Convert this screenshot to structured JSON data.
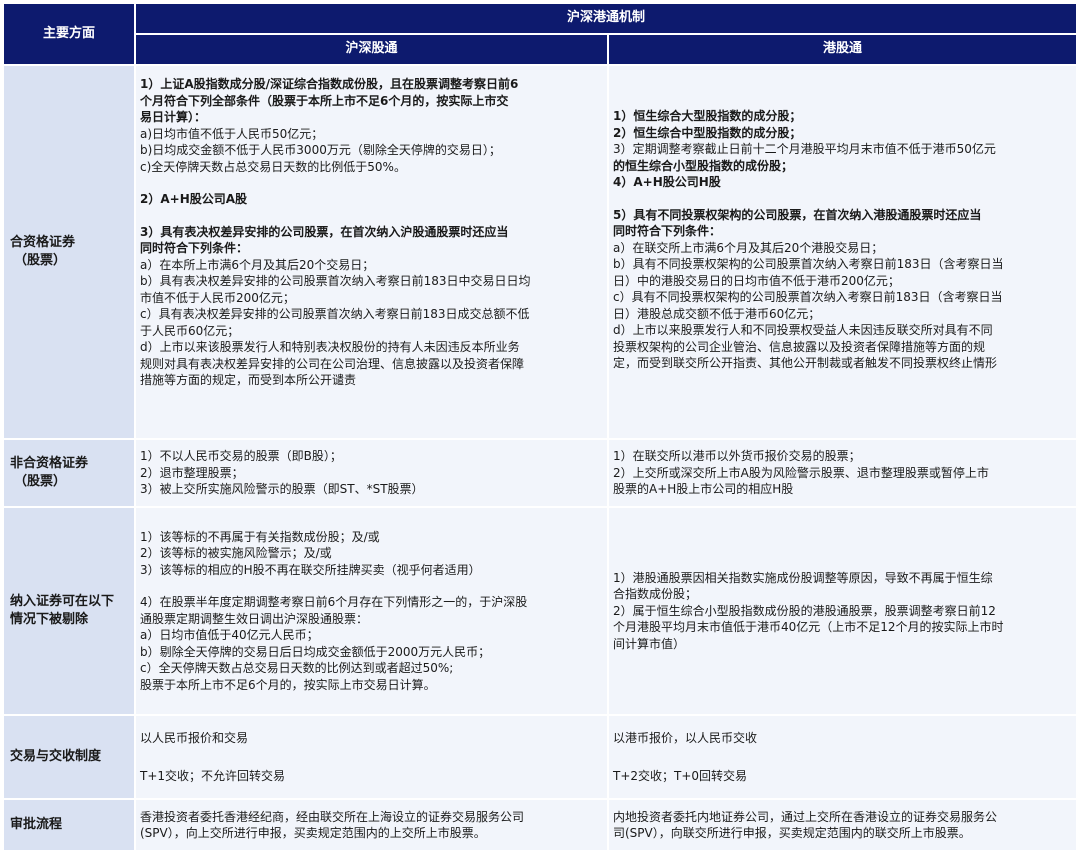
{
  "header": {
    "left": "主要方面",
    "top": "沪深港通机制",
    "col_a": "沪深股通",
    "col_b": "港股通"
  },
  "rows": {
    "eligible": {
      "label": [
        "合资格证券",
        "（股票）"
      ],
      "a": [
        {
          "t": "1）上证A股指数成分股/深证综合指数成份股，且在股票调整考察日前6",
          "b": true
        },
        {
          "t": "个月符合下列全部条件（股票于本所上市不足6个月的，按实际上市交",
          "b": true
        },
        {
          "t": "易日计算）：",
          "b": true
        },
        {
          "t": "a)日均市值不低于人民币50亿元；",
          "b": false
        },
        {
          "t": "b)日均成交金额不低于人民币3000万元（剔除全天停牌的交易日）；",
          "b": false
        },
        {
          "t": "c)全天停牌天数占总交易日天数的比例低于50%。",
          "b": false
        },
        {
          "gap": true
        },
        {
          "t": "2）A+H股公司A股",
          "b": true
        },
        {
          "gap": true
        },
        {
          "t": "3）具有表决权差异安排的公司股票，在首次纳入沪股通股票时还应当",
          "b": true
        },
        {
          "t": "同时符合下列条件：",
          "b": true
        },
        {
          "t": "a）在本所上市满6个月及其后20个交易日；",
          "b": false
        },
        {
          "t": "b）具有表决权差异安排的公司股票首次纳入考察日前183日中交易日日均",
          "b": false
        },
        {
          "t": "市值不低于人民币200亿元；",
          "b": false
        },
        {
          "t": "c）具有表决权差异安排的公司股票首次纳入考察日前183日成交总额不低",
          "b": false
        },
        {
          "t": "于人民币60亿元；",
          "b": false
        },
        {
          "t": "d）上市以来该股票发行人和特别表决权股份的持有人未因违反本所业务",
          "b": false
        },
        {
          "t": "规则对具有表决权差异安排的公司在公司治理、信息披露以及投资者保障",
          "b": false
        },
        {
          "t": "措施等方面的规定，而受到本所公开谴责",
          "b": false
        }
      ],
      "b": [
        {
          "t": "1）恒生综合大型股指数的成分股；",
          "b": true
        },
        {
          "t": "2）恒生综合中型股指数的成分股；",
          "b": true
        },
        {
          "t": "3）定期调整考察截止日前十二个月港股平均月末市值不低于港币50亿元",
          "b": false,
          "mixed": "3"
        },
        {
          "t": "的恒生综合小型股指数的成份股；",
          "b": true
        },
        {
          "t": "4）A+H股公司H股",
          "b": true
        },
        {
          "gap": true
        },
        {
          "t": "5）具有不同投票权架构的公司股票，在首次纳入港股通股票时还应当",
          "b": true
        },
        {
          "t": "同时符合下列条件：",
          "b": true
        },
        {
          "t": "a）在联交所上市满6个月及其后20个港股交易日；",
          "b": false
        },
        {
          "t": "b）具有不同投票权架构的公司股票首次纳入考察日前183日（含考察日当",
          "b": false
        },
        {
          "t": "日）中的港股交易日的日均市值不低于港币200亿元；",
          "b": false
        },
        {
          "t": "c）具有不同投票权架构的公司股票首次纳入考察日前183日（含考察日当",
          "b": false
        },
        {
          "t": "日）港股总成交额不低于港币60亿元；",
          "b": false
        },
        {
          "t": "d）上市以来股票发行人和不同投票权受益人未因违反联交所对具有不同",
          "b": false
        },
        {
          "t": "投票权架构的公司企业管治、信息披露以及投资者保障措施等方面的规",
          "b": false
        },
        {
          "t": "定，而受到联交所公开指责、其他公开制裁或者触发不同投票权终止情形",
          "b": false
        }
      ]
    },
    "ineligible": {
      "label": [
        "非合资格证券",
        "（股票）"
      ],
      "a": [
        "1）不以人民币交易的股票（即B股）；",
        "2）退市整理股票；",
        "3）被上交所实施风险警示的股票（即ST、*ST股票）"
      ],
      "b": [
        "1）在联交所以港币以外货币报价交易的股票；",
        "2）上交所或深交所上市A股为风险警示股票、退市整理股票或暂停上市",
        "股票的A+H股上市公司的相应H股"
      ]
    },
    "removal": {
      "label": [
        "纳入证券可在以下",
        "情况下被剔除"
      ],
      "a": [
        "1）该等标的不再属于有关指数成份股；及/或",
        "2）该等标的被实施风险警示；及/或",
        "3）该等标的相应的H股不再在联交所挂牌买卖（视乎何者适用）",
        "",
        "4）在股票半年度定期调整考察日前6个月存在下列情形之一的，于沪深股",
        "通股票定期调整生效日调出沪深股通股票：",
        "a）日均市值低于40亿元人民币；",
        "b）剔除全天停牌的交易日后日均成交金额低于2000万元人民币；",
        "c）全天停牌天数占总交易日天数的比例达到或者超过50%;",
        "股票于本所上市不足6个月的，按实际上市交易日计算。"
      ],
      "b": [
        "1）港股通股票因相关指数实施成份股调整等原因，导致不再属于恒生综",
        "合指数成份股；",
        "2）属于恒生综合小型股指数成份股的港股通股票，股票调整考察日前12",
        "个月港股平均月末市值低于港币40亿元（上市不足12个月的按实际上市时",
        "间计算市值）"
      ]
    },
    "trading": {
      "label": [
        "交易与交收制度"
      ],
      "a": [
        "以人民币报价和交易",
        "T+1交收；不允许回转交易"
      ],
      "b": [
        "以港币报价，以人民币交收",
        "T+2交收；T+0回转交易"
      ]
    },
    "approval": {
      "label": [
        "审批流程"
      ],
      "a": [
        "香港投资者委托香港经纪商，经由联交所在上海设立的证券交易服务公司",
        "(SPV），向上交所进行申报，买卖规定范围内的上交所上市股票。"
      ],
      "b": [
        "内地投资者委托内地证券公司，通过上交所在香港设立的证券交易服务公",
        "司(SPV），向联交所进行申报，买卖规定范围内的联交所上市股票。"
      ]
    }
  }
}
